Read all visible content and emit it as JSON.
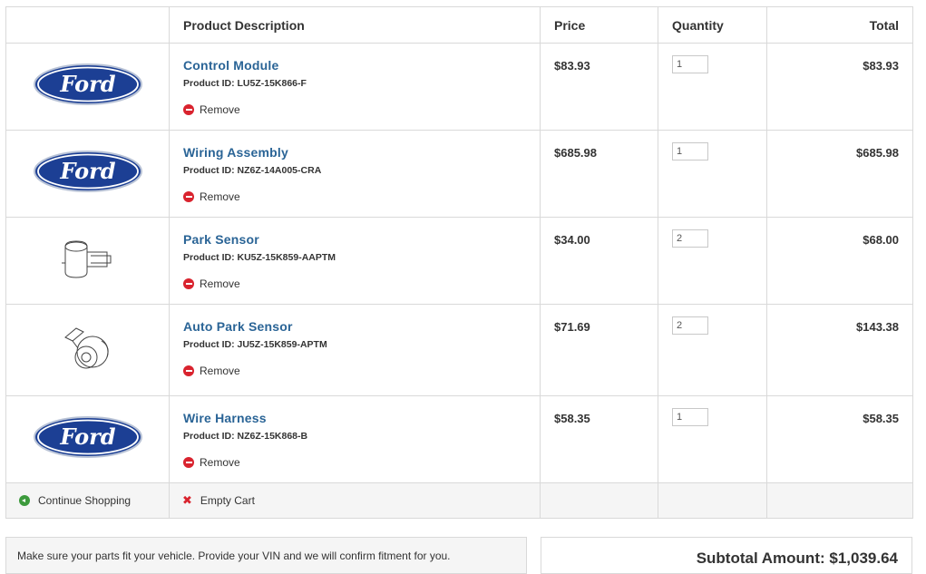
{
  "header": {
    "image": "",
    "description": "Product Description",
    "price": "Price",
    "quantity": "Quantity",
    "total": "Total"
  },
  "items": [
    {
      "image": "ford-logo",
      "name": "Control Module",
      "product_id": "Product ID: LU5Z-15K866-F",
      "remove": "Remove",
      "price": "$83.93",
      "quantity": "1",
      "total": "$83.93"
    },
    {
      "image": "ford-logo",
      "name": "Wiring Assembly",
      "product_id": "Product ID: NZ6Z-14A005-CRA",
      "remove": "Remove",
      "price": "$685.98",
      "quantity": "1",
      "total": "$685.98"
    },
    {
      "image": "park-sensor-drawing",
      "name": "Park Sensor",
      "product_id": "Product ID: KU5Z-15K859-AAPTM",
      "remove": "Remove",
      "price": "$34.00",
      "quantity": "2",
      "total": "$68.00"
    },
    {
      "image": "auto-park-sensor-drawing",
      "name": "Auto Park Sensor",
      "product_id": "Product ID: JU5Z-15K859-APTM",
      "remove": "Remove",
      "price": "$71.69",
      "quantity": "2",
      "total": "$143.38"
    },
    {
      "image": "ford-logo",
      "name": "Wire Harness",
      "product_id": "Product ID: NZ6Z-15K868-B",
      "remove": "Remove",
      "price": "$58.35",
      "quantity": "1",
      "total": "$58.35"
    }
  ],
  "footer": {
    "continue_shopping": "Continue Shopping",
    "empty_cart": "Empty Cart"
  },
  "vin_notice": "Make sure your parts fit your vehicle. Provide your VIN and we will confirm fitment for you.",
  "subtotal": "Subtotal Amount: $1,039.64",
  "colors": {
    "link": "#2a6496",
    "remove_icon": "#d9232e",
    "continue_icon": "#3c9a3c",
    "ford_blue": "#1c3f94"
  },
  "logo_text": "Ford"
}
